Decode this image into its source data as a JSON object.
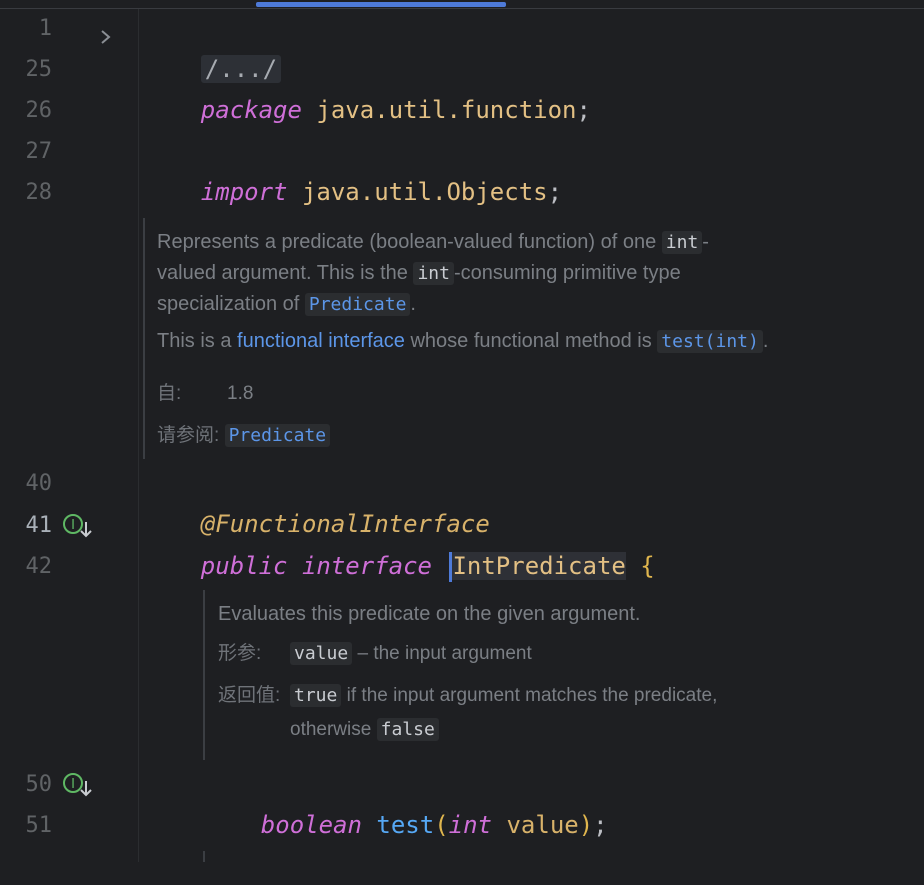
{
  "tab": {
    "active_indicator": "active-tab"
  },
  "lines": [
    {
      "num": "1",
      "parts": [
        {
          "text": "/.../",
          "cls": "folded"
        }
      ]
    },
    {
      "num": "25",
      "parts": [
        {
          "text": "package",
          "cls": "kw"
        },
        {
          "text": " "
        },
        {
          "text": "java.util.function",
          "cls": "pkg"
        },
        {
          "text": ";",
          "cls": "punct"
        }
      ]
    },
    {
      "num": "26"
    },
    {
      "num": "27",
      "parts": [
        {
          "text": "import",
          "cls": "kw"
        },
        {
          "text": " "
        },
        {
          "text": "java.util.Objects",
          "cls": "pkg"
        },
        {
          "text": ";",
          "cls": "punct"
        }
      ]
    },
    {
      "num": "28"
    },
    {
      "num": "40",
      "parts": [
        {
          "text": "@FunctionalInterface",
          "cls": "ann"
        }
      ]
    },
    {
      "num": "41",
      "parts": [
        {
          "text": "public",
          "cls": "kw"
        },
        {
          "text": " "
        },
        {
          "text": "interface",
          "cls": "kw"
        },
        {
          "text": " "
        },
        {
          "text": "IntPredicate",
          "cls": "cls"
        },
        {
          "text": " "
        },
        {
          "text": "{",
          "cls": "brace"
        }
      ]
    },
    {
      "num": "42"
    },
    {
      "num": "50",
      "parts": [
        {
          "text": "boolean",
          "cls": "prim"
        },
        {
          "text": " "
        },
        {
          "text": "test",
          "cls": "fn"
        },
        {
          "text": "(",
          "cls": "brace"
        },
        {
          "text": "int",
          "cls": "prim"
        },
        {
          "text": " "
        },
        {
          "text": "value",
          "cls": "param"
        },
        {
          "text": ")",
          "cls": "brace"
        },
        {
          "text": ";",
          "cls": "punct"
        }
      ]
    },
    {
      "num": "51"
    }
  ],
  "doc1": {
    "p1_a": "Represents a predicate (boolean-valued function) of one",
    "p1_code1": "int",
    "p1_b": "-",
    "p1_c": "valued argument. This is the",
    "p1_code2": "int",
    "p1_d": "-consuming primitive type",
    "p1_e": "specialization of",
    "p1_link": "Predicate",
    "p1_f": ".",
    "p2_a": "This is a",
    "p2_link": "functional interface",
    "p2_b": "whose functional method is",
    "p2_code": "test(int)",
    "p2_c": ".",
    "since_label": "自:",
    "since_value": "1.8",
    "see_label": "请参阅:",
    "see_link": "Predicate"
  },
  "doc2": {
    "summary": "Evaluates this predicate on the given argument.",
    "param_label": "形参:",
    "param_code": "value",
    "param_desc": "– the input argument",
    "return_label": "返回值:",
    "return_code1": "true",
    "return_desc1": "if the input argument matches the predicate,",
    "return_desc2": "otherwise",
    "return_code2": "false"
  },
  "gutter_icons": {
    "impl_icon": "implemented-icon",
    "fold_icon": "chevron-right-icon"
  },
  "colors": {
    "background": "#1e1f22",
    "keyword": "#cf6fd8",
    "class": "#e3c084",
    "link": "#5c96e8",
    "caret": "#4e7ad8"
  }
}
